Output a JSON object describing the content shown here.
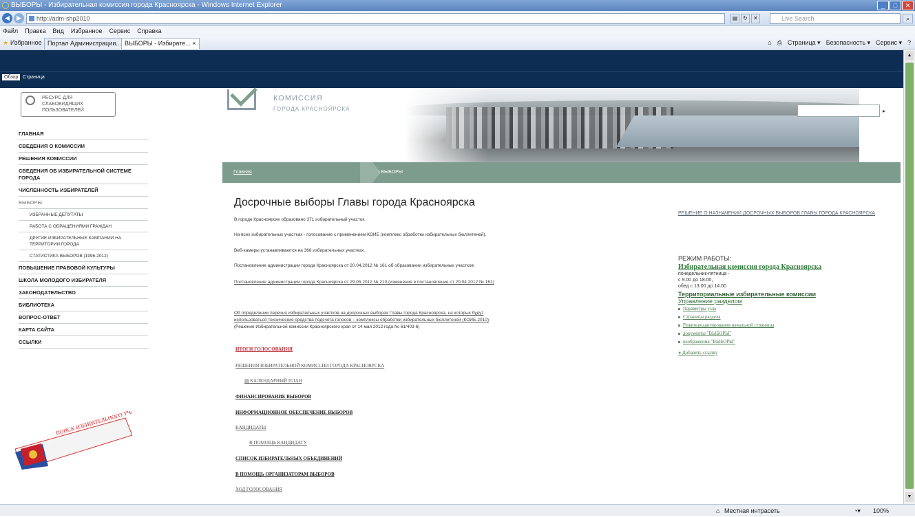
{
  "window": {
    "title": "ВЫБОРЫ - Избирательная комиссия города Красноярска - Windows Internet Explorer"
  },
  "address": {
    "url": "http://adm-shp2010",
    "search_placeholder": "Live Search"
  },
  "menu": [
    "Файл",
    "Правка",
    "Вид",
    "Избранное",
    "Сервис",
    "Справка"
  ],
  "favorites": {
    "label": "Избранное",
    "tabs": [
      "Портал Администрации...",
      "ВЫБОРЫ - Избирате... ×"
    ]
  },
  "commands": [
    "Страница ▾",
    "Безопасность ▾",
    "Сервис ▾"
  ],
  "ribbon": [
    "Обзор",
    "Страница"
  ],
  "left": {
    "access_text": "РЕСУРС ДЛЯ СЛАБОВИДЯЩИХ ПОЛЬЗОВАТЕЛЕЙ",
    "nav": [
      {
        "label": "ГЛАВНАЯ"
      },
      {
        "label": "СВЕДЕНИЯ О КОМИССИИ"
      },
      {
        "label": "РЕШЕНИЯ КОМИССИИ"
      },
      {
        "label": "СВЕДЕНИЯ ОБ ИЗБИРАТЕЛЬНОЙ СИСТЕМЕ ГОРОДА"
      },
      {
        "label": "ЧИСЛЕННОСТЬ ИЗБИРАТЕЛЕЙ"
      },
      {
        "label": "ВЫБОРЫ"
      },
      {
        "label": "ИЗБРАННЫЕ ДЕПУТАТЫ"
      },
      {
        "label": "РАБОТА С ОБРАЩЕНИЯМИ ГРАЖДАН"
      },
      {
        "label": "ДРУГИЕ ИЗБИРАТЕЛЬНЫЕ КАМПАНИИ НА ТЕРРИТОРИИ ГОРОДА"
      },
      {
        "label": "СТАТИСТИКА ВЫБОРОВ (1996-2012)"
      },
      {
        "label": "ПОВЫШЕНИЕ ПРАВОВОЙ КУЛЬТУРЫ"
      },
      {
        "label": "ШКОЛА МОЛОДОГО ИЗБИРАТЕЛЯ"
      },
      {
        "label": "ЗАКОНОДАТЕЛЬСТВО"
      },
      {
        "label": "БИБЛИОТЕКА"
      },
      {
        "label": "ВОПРОС-ОТВЕТ"
      },
      {
        "label": "КАРТА САЙТА"
      },
      {
        "label": "ССЫЛКИ"
      }
    ],
    "banner_text": "ПОИСК ИЗБИРАТЕЛЬНОГО УЧАСТКА"
  },
  "header": {
    "org_line1": "КОМИССИЯ",
    "org_line2": "ГОРОДА КРАСНОЯРСКА"
  },
  "breadcrumb": {
    "home": "Главная",
    "current": "› ВЫБОРЫ"
  },
  "main": {
    "title": "Досрочные выборы Главы города Красноярска",
    "p1": "В городе Красноярске образовано 371 избирательный участок.",
    "p2": "На всех избирательных участках - голосование с применением КОИБ (комплекс обработки избирательных бюллетеней).",
    "p3": "Веб-камеры устанавливаются на 368 избирательных участках.",
    "p4_link": "Постановление администрации города Красноярска от 20.04.2012 № 161",
    "p4_rest": " об образовании избирательных участков",
    "p5": "Постановление администрации города Красноярска от 29.05.2012 № 210 (изменения в постановление от 20.04.2012 № 161)",
    "p6a": "Об определении перечня избирательных участков на досрочных выборах Главы города Красноярска, на которых будут",
    "p6b": "использоваться технические средства подсчета голосов – комплексы обработки избирательных бюллетеней (КОИБ-2010)",
    "p6c": "(Решение Избирательной комиссии Красноярского края от 14 мая 2012 года № 61/403-6)",
    "links": [
      "ИТОГИ ГОЛОСОВАНИЯ",
      "РЕШЕНИЯ ИЗБИРАТЕЛЬНОЙ КОМИССИИ ГОРОДА КРАСНОЯРСКА",
      "КАЛЕНДАРНЫЙ ПЛАН",
      "ФИНАНСИРОВАНИЕ ВЫБОРОВ",
      "ИНФОРМАЦИОННОЕ ОБЕСПЕЧЕНИЕ ВЫБОРОВ",
      "КАНДИДАТЫ",
      "В ПОМОЩЬ КАНДИДАТУ",
      "СПИСОК ИЗБИРАТЕЛЬНЫХ ОБЪЕДИНЕНИЙ",
      "В ПОМОЩЬ ОРГАНИЗАТОРАМ ВЫБОРОВ",
      "ХОД ГОЛОСОВАНИЯ"
    ]
  },
  "right": {
    "decision": "РЕШЕНИЕ О НАЗНАЧЕНИИ ДОСРОЧНЫХ ВЫБОРОВ ГЛАВЫ ГОРОДА КРАСНОЯРСКА",
    "mode_title": "РЕЖИМ РАБОТЫ:",
    "commission": "Избирательная комиссия города Красноярска",
    "days": "понедельник-пятница -",
    "hours": "с 9.00 до 18.00,",
    "lunch": "обед с 13.00 до 14.00",
    "territorial": "Территориальные избирательные комиссии",
    "manage": "Управление разделом",
    "items": [
      "Параметры узла",
      "Страницы раздела",
      "Режим редактирования начальной страницы",
      "документы \"ВЫБОРЫ\"",
      "изображения \"ВЫБОРЫ\""
    ],
    "add": "Добавить ссылку"
  },
  "status": {
    "zone": "Местная интрасеть",
    "zoom": "100%"
  }
}
